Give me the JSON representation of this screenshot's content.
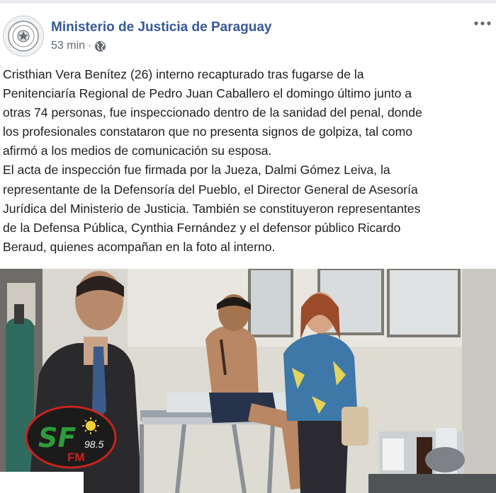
{
  "post": {
    "author": "Ministerio de Justicia de Paraguay",
    "time": "53 min",
    "separator": "·",
    "privacy_icon": "globe-icon",
    "more_icon": "more-options-icon",
    "paragraphs": [
      "Cristhian Vera Benítez (26) interno recapturado tras fugarse de la",
      "Penitenciaría Regional de Pedro Juan Caballero el domingo último junto a",
      "otras 74 personas, fue inspeccionado dentro de la sanidad del penal, donde",
      "los profesionales constataron que no presenta signos de golpiza, tal como",
      "afirmó a los medios de comunicación su esposa.",
      "El acta de inspección fue firmada por la Jueza, Dalmi Gómez Leiva, la",
      "representante de la Defensoría del Pueblo, el Director General de Asesoría",
      "Jurídica del Ministerio de Justicia. También se constituyeron representantes",
      "de la Defensa Pública, Cynthia Fernández y el defensor público Ricardo",
      "Beraud, quienes acompañan en la foto al interno."
    ]
  },
  "photo": {
    "watermark": {
      "letters_sf": "SF",
      "frequency": "98.5",
      "letters_fm": "FM"
    }
  },
  "colors": {
    "author_link": "#365899",
    "meta_gray": "#616770",
    "body_text": "#1c1e21",
    "logo_green": "#2e9b3a",
    "logo_red": "#c8241f"
  }
}
